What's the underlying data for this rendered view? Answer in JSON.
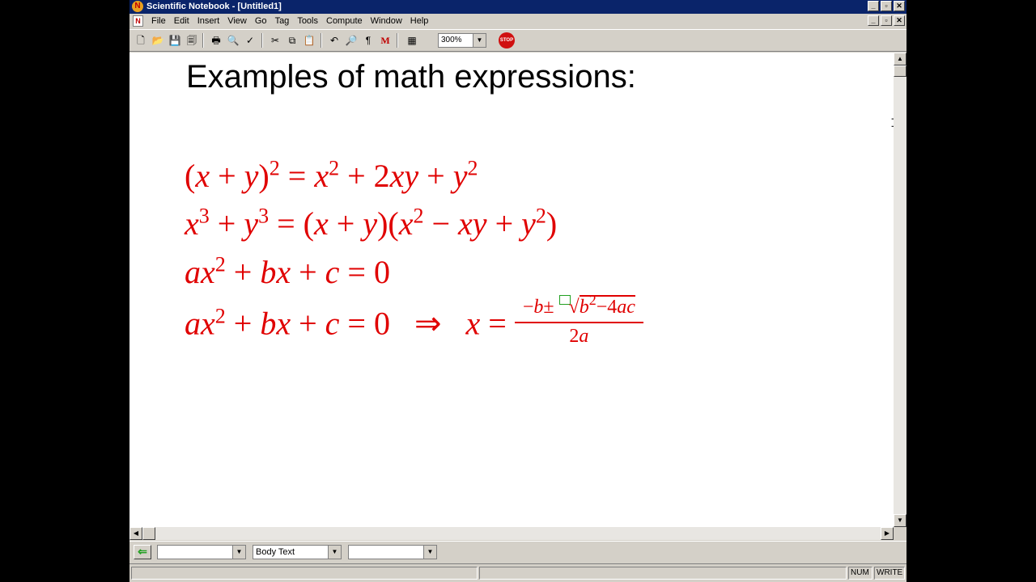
{
  "window": {
    "title": "Scientific Notebook - [Untitled1]"
  },
  "title_buttons": {
    "minimize": "_",
    "restore": "▫",
    "close": "✕"
  },
  "menu": [
    "File",
    "Edit",
    "Insert",
    "View",
    "Go",
    "Tag",
    "Tools",
    "Compute",
    "Window",
    "Help"
  ],
  "toolbar": {
    "zoom": "300%",
    "stop_label": "STOP",
    "buttons": [
      "new-document",
      "open",
      "save",
      "save-all",
      "print",
      "print-preview",
      "spell-check",
      "cut",
      "copy",
      "paste",
      "undo",
      "find",
      "paragraph-marks",
      "math-mode",
      "table"
    ]
  },
  "document": {
    "heading": "Examples of math expressions:",
    "eq1": {
      "lhs_open": "(",
      "x": "x",
      "plus": " + ",
      "y": "y",
      "close": ")",
      "exp": "2",
      "eq": " = ",
      "r1": "x",
      "r1exp": "2",
      "r2": " + 2",
      "r2v": "xy",
      "r3": " + ",
      "r3v": "y",
      "r3exp": "2"
    },
    "eq2": {
      "x": "x",
      "xexp": "3",
      "plus": " + ",
      "y": "y",
      "yexp": "3",
      "eq": " = ",
      "p1": "(",
      "p1x": "x",
      "p1plus": " + ",
      "p1y": "y",
      "p1c": ")(",
      "p2x": "x",
      "p2xexp": "2",
      "minus": " − ",
      "xy": "xy",
      "plus2": " + ",
      "y2": "y",
      "y2exp": "2",
      "close": ")"
    },
    "eq3": {
      "a": "ax",
      "aexp": "2",
      "plus1": " + ",
      "bx": "bx",
      "plus2": " + ",
      "c": "c",
      "eq": " = 0"
    },
    "eq4": {
      "a": "ax",
      "aexp": "2",
      "plus1": " + ",
      "bx": "bx",
      "plus2": " + ",
      "c": "c",
      "eq": " = 0",
      "implies": "   ⇒   ",
      "x": "x",
      "eq2": " = ",
      "num_pre": "−",
      "num_b": "b",
      "num_pm": "±",
      "root": "√",
      "num_b2": "b",
      "num_b2exp": "2",
      "num_minus": "−4",
      "num_ac": "ac",
      "den_2": "2",
      "den_a": "a"
    }
  },
  "tagbar": {
    "combo1": "",
    "combo2": "Body Text",
    "combo3": ""
  },
  "statusbar": {
    "num": "NUM",
    "write": "WRITE"
  },
  "colors": {
    "math": "#e00000",
    "titlebar": "#0a246a",
    "chrome": "#d4d0c8"
  }
}
